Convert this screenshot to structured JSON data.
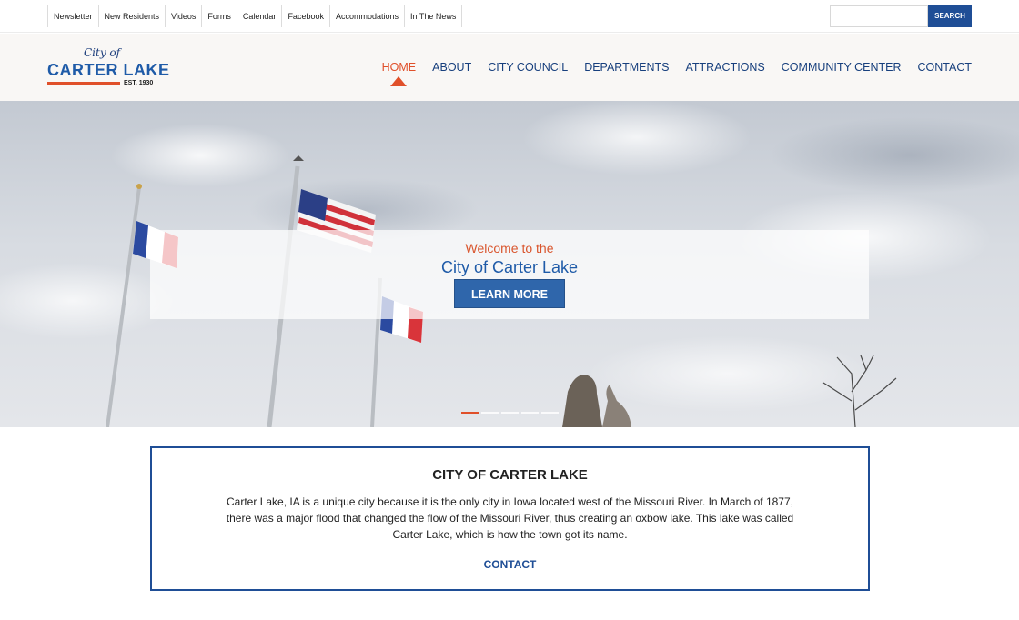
{
  "top_links": [
    "Newsletter",
    "New Residents",
    "Videos",
    "Forms",
    "Calendar",
    "Facebook",
    "Accommodations",
    "In The News"
  ],
  "search": {
    "placeholder": "",
    "button_label": "SEARCH"
  },
  "logo": {
    "city_of": "City of",
    "name": "CARTER LAKE",
    "est": "EST. 1930"
  },
  "nav": {
    "items": [
      "HOME",
      "ABOUT",
      "CITY COUNCIL",
      "DEPARTMENTS",
      "ATTRACTIONS",
      "COMMUNITY CENTER",
      "CONTACT"
    ],
    "active": "HOME"
  },
  "hero": {
    "kicker": "Welcome to the",
    "title": "City of Carter Lake",
    "button_label": "LEARN MORE",
    "slides": 5,
    "active_slide": 1
  },
  "intro": {
    "title": "CITY OF CARTER LAKE",
    "body": "Carter Lake, IA is a unique city because it is the only city in Iowa located west of the Missouri River. In March of 1877, there was a major flood that changed the flow of the Missouri River, thus creating an oxbow lake. This lake was called Carter Lake, which is how the town got its name.",
    "link_label": "CONTACT"
  },
  "colors": {
    "brand_blue": "#1f4e96",
    "accent_orange": "#e0502a",
    "nav_blue": "#173f7d"
  }
}
